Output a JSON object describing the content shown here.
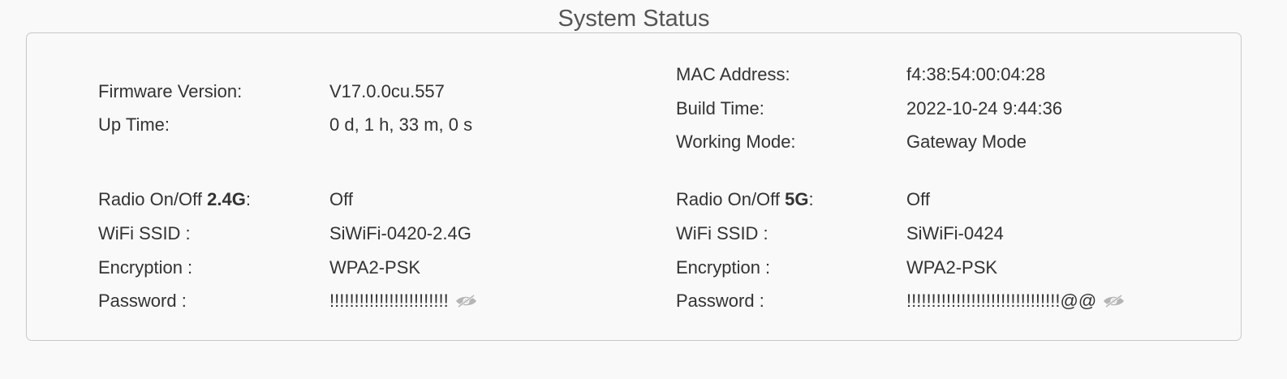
{
  "page": {
    "title": "System Status"
  },
  "left": {
    "firmware": {
      "label": "Firmware Version:",
      "value": "V17.0.0cu.557"
    },
    "uptime": {
      "label": "Up Time:",
      "value": "0 d, 1 h, 33 m, 0 s"
    },
    "radio": {
      "label_prefix": "Radio On/Off ",
      "band": "2.4G",
      "label_suffix": ":",
      "value": "Off"
    },
    "ssid": {
      "label": "WiFi SSID :",
      "value": "SiWiFi-0420-2.4G"
    },
    "encryption": {
      "label": "Encryption :",
      "value": "WPA2-PSK"
    },
    "password": {
      "label": "Password :",
      "value": "!!!!!!!!!!!!!!!!!!!!!!!!",
      "toggle_icon": "eye-slash-icon"
    }
  },
  "right": {
    "mac": {
      "label": "MAC Address:",
      "value": "f4:38:54:00:04:28"
    },
    "build": {
      "label": "Build Time:",
      "value": "2022-10-24 9:44:36"
    },
    "mode": {
      "label": "Working Mode:",
      "value": "Gateway Mode"
    },
    "radio": {
      "label_prefix": "Radio On/Off ",
      "band": "5G",
      "label_suffix": ":",
      "value": "Off"
    },
    "ssid": {
      "label": "WiFi SSID :",
      "value": "SiWiFi-0424"
    },
    "encryption": {
      "label": "Encryption :",
      "value": "WPA2-PSK"
    },
    "password": {
      "label": "Password :",
      "value": "!!!!!!!!!!!!!!!!!!!!!!!!!!!!!!!@@",
      "toggle_icon": "eye-slash-icon"
    }
  },
  "colors": {
    "text": "#333333",
    "title": "#555555",
    "border": "#c8c8c8",
    "background": "#f9f9f9",
    "icon": "#aaaaaa"
  }
}
